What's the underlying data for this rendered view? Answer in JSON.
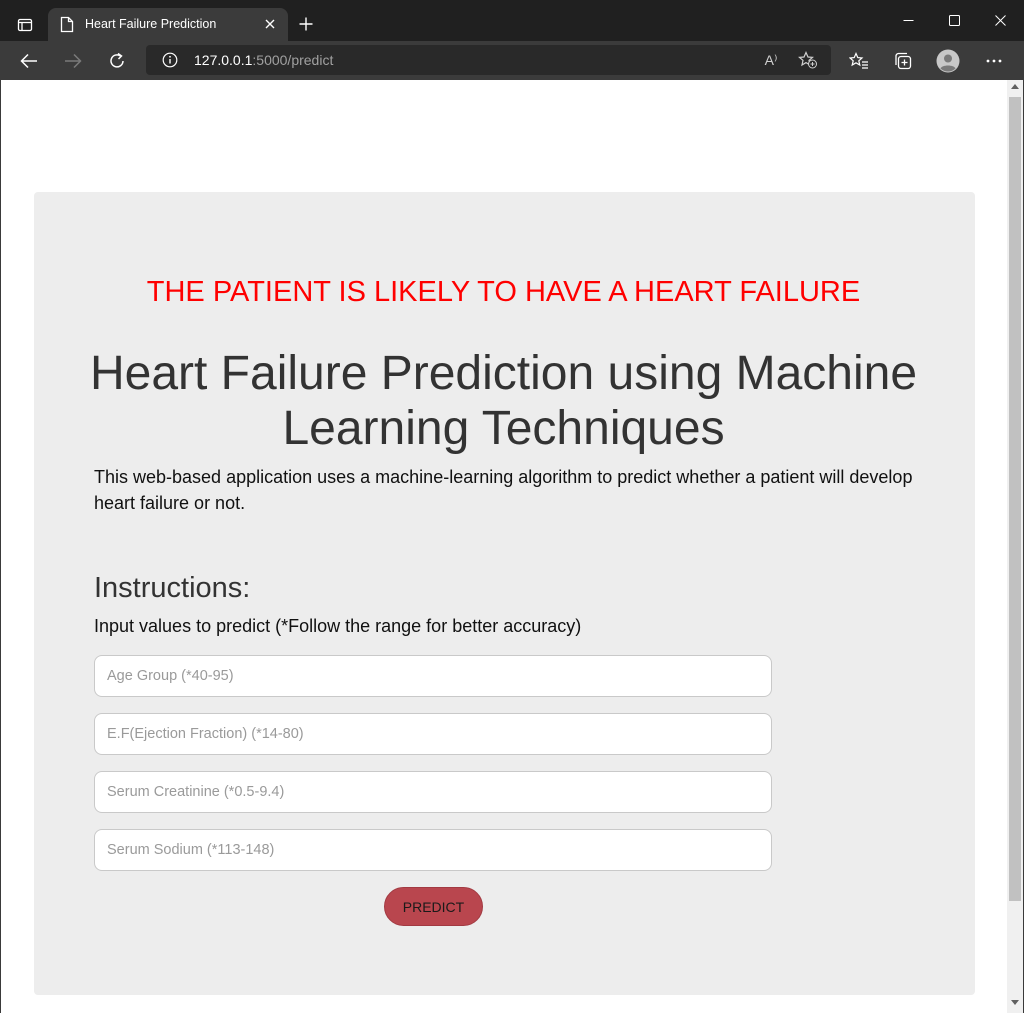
{
  "browser": {
    "tab_title": "Heart Failure Prediction",
    "url_host": "127.0.0.1",
    "url_rest": ":5000/predict",
    "read_aloud_glyph": "A⁾",
    "icons": {
      "tab_actions": "tab-actions-icon",
      "favicon": "page-icon",
      "close": "close-icon",
      "new_tab": "plus-icon",
      "back": "back-arrow-icon",
      "forward": "forward-arrow-icon",
      "refresh": "refresh-icon",
      "info": "info-icon",
      "read_aloud": "read-aloud-icon",
      "add_favorite": "add-favorite-icon",
      "favorites": "favorites-icon",
      "collections": "collections-icon",
      "profile": "profile-icon",
      "more": "more-icon"
    }
  },
  "page": {
    "result": "THE PATIENT IS LIKELY TO HAVE A HEART FAILURE",
    "title": "Heart Failure Prediction using Machine Learning Techniques",
    "description": "This web-based application uses a machine-learning algorithm to predict whether a patient will develop heart failure or not.",
    "instructions_heading": "Instructions:",
    "instructions_text": "Input values to predict (*Follow the range for better accuracy)",
    "fields": [
      {
        "placeholder": "Age Group (*40-95)",
        "value": ""
      },
      {
        "placeholder": "E.F(Ejection Fraction) (*14-80)",
        "value": ""
      },
      {
        "placeholder": "Serum Creatinine (*0.5-9.4)",
        "value": ""
      },
      {
        "placeholder": "Serum Sodium (*113-148)",
        "value": ""
      }
    ],
    "predict_label": "PREDICT"
  },
  "colors": {
    "result": "#ff0000",
    "card_bg": "#ededed",
    "button": "#b9464e",
    "chrome_dark": "#202020",
    "chrome_toolbar": "#3b3b3b"
  }
}
